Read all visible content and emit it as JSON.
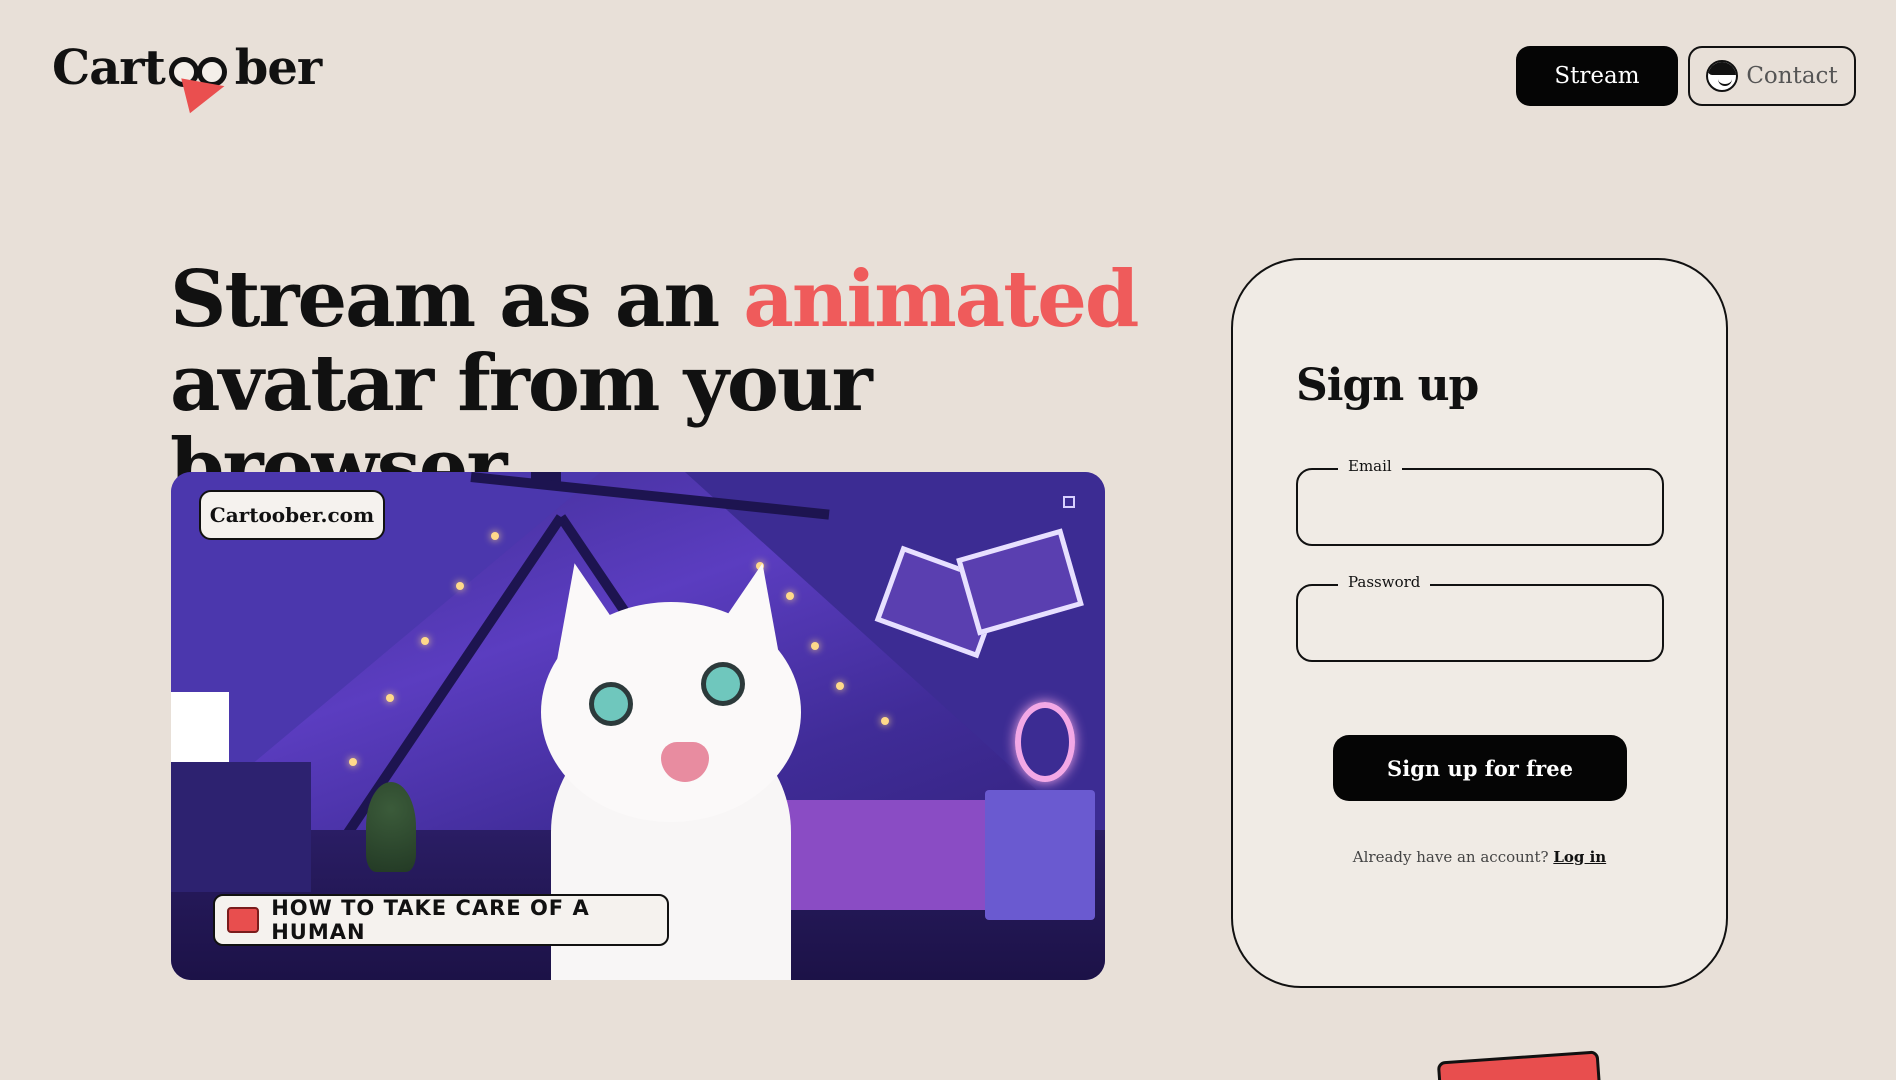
{
  "header": {
    "logo_left": "Cart",
    "logo_right": "ber",
    "nav": {
      "stream_label": "Stream",
      "contact_label": "Contact"
    }
  },
  "hero": {
    "headline_part1": "Stream as an ",
    "headline_accent": "animated",
    "headline_part2": "avatar from your browser",
    "accent_color": "#ef5b5b"
  },
  "preview": {
    "site_badge": "Cartoober.com",
    "caption": "HOW TO TAKE CARE OF A HUMAN",
    "icons": [
      "expand-icon",
      "ticket-icon"
    ]
  },
  "signup": {
    "title": "Sign up",
    "email_label": "Email",
    "email_value": "",
    "password_label": "Password",
    "password_value": "",
    "submit_label": "Sign up for free",
    "already_text": "Already have an account?",
    "login_link": "Log in"
  },
  "colors": {
    "background": "#e8e0d8",
    "card": "#f0ebe5",
    "primary_button": "#050505",
    "brand_red": "#ea4f4f"
  }
}
